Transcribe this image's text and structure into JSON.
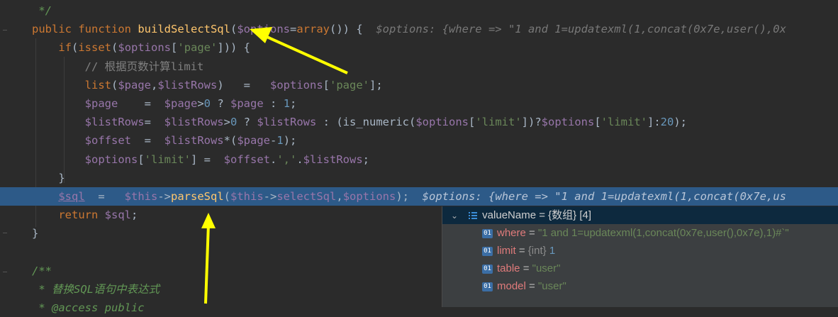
{
  "code_lines": [
    {
      "id": "doc-end",
      "segments": [
        {
          "t": " */",
          "c": "doccmt"
        }
      ]
    },
    {
      "id": "function-decl",
      "segments": [
        {
          "t": "public ",
          "c": "kw"
        },
        {
          "t": "function ",
          "c": "kw"
        },
        {
          "t": "buildSelectSql",
          "c": "fn"
        },
        {
          "t": "(",
          "c": ""
        },
        {
          "t": "$options",
          "c": "var"
        },
        {
          "t": "=",
          "c": ""
        },
        {
          "t": "array",
          "c": "kw"
        },
        {
          "t": "()) {  ",
          "c": ""
        },
        {
          "t": "$options: {where => \"1 and 1=updatexml(1,concat(0x7e,user(),0x",
          "c": "hint"
        }
      ]
    },
    {
      "id": "if-isset",
      "segments": [
        {
          "t": "    ",
          "c": ""
        },
        {
          "t": "if",
          "c": "kw"
        },
        {
          "t": "(",
          "c": ""
        },
        {
          "t": "isset",
          "c": "kw"
        },
        {
          "t": "(",
          "c": ""
        },
        {
          "t": "$options",
          "c": "var"
        },
        {
          "t": "[",
          "c": ""
        },
        {
          "t": "'page'",
          "c": "str"
        },
        {
          "t": "])) {",
          "c": ""
        }
      ]
    },
    {
      "id": "comment-line",
      "segments": [
        {
          "t": "        // 根据页数计算limit",
          "c": "cmt"
        }
      ]
    },
    {
      "id": "list-line",
      "segments": [
        {
          "t": "        ",
          "c": ""
        },
        {
          "t": "list",
          "c": "kw"
        },
        {
          "t": "(",
          "c": ""
        },
        {
          "t": "$page",
          "c": "var"
        },
        {
          "t": ",",
          "c": ""
        },
        {
          "t": "$listRows",
          "c": "var"
        },
        {
          "t": ")   =   ",
          "c": ""
        },
        {
          "t": "$options",
          "c": "var"
        },
        {
          "t": "[",
          "c": ""
        },
        {
          "t": "'page'",
          "c": "str"
        },
        {
          "t": "];",
          "c": ""
        }
      ]
    },
    {
      "id": "page-line",
      "segments": [
        {
          "t": "        ",
          "c": ""
        },
        {
          "t": "$page",
          "c": "var"
        },
        {
          "t": "    =  ",
          "c": ""
        },
        {
          "t": "$page",
          "c": "var"
        },
        {
          "t": ">",
          "c": ""
        },
        {
          "t": "0",
          "c": "num"
        },
        {
          "t": " ? ",
          "c": ""
        },
        {
          "t": "$page",
          "c": "var"
        },
        {
          "t": " : ",
          "c": ""
        },
        {
          "t": "1",
          "c": "num"
        },
        {
          "t": ";",
          "c": ""
        }
      ]
    },
    {
      "id": "listrows-line",
      "segments": [
        {
          "t": "        ",
          "c": ""
        },
        {
          "t": "$listRows",
          "c": "var"
        },
        {
          "t": "=  ",
          "c": ""
        },
        {
          "t": "$listRows",
          "c": "var"
        },
        {
          "t": ">",
          "c": ""
        },
        {
          "t": "0",
          "c": "num"
        },
        {
          "t": " ? ",
          "c": ""
        },
        {
          "t": "$listRows",
          "c": "var"
        },
        {
          "t": " : (is_numeric(",
          "c": ""
        },
        {
          "t": "$options",
          "c": "var"
        },
        {
          "t": "[",
          "c": ""
        },
        {
          "t": "'limit'",
          "c": "str"
        },
        {
          "t": "])?",
          "c": ""
        },
        {
          "t": "$options",
          "c": "var"
        },
        {
          "t": "[",
          "c": ""
        },
        {
          "t": "'limit'",
          "c": "str"
        },
        {
          "t": "]:",
          "c": ""
        },
        {
          "t": "20",
          "c": "num"
        },
        {
          "t": ");",
          "c": ""
        }
      ]
    },
    {
      "id": "offset-line",
      "segments": [
        {
          "t": "        ",
          "c": ""
        },
        {
          "t": "$offset",
          "c": "var"
        },
        {
          "t": "  =  ",
          "c": ""
        },
        {
          "t": "$listRows",
          "c": "var"
        },
        {
          "t": "*(",
          "c": ""
        },
        {
          "t": "$page",
          "c": "var"
        },
        {
          "t": "-",
          "c": ""
        },
        {
          "t": "1",
          "c": "num"
        },
        {
          "t": ");",
          "c": ""
        }
      ]
    },
    {
      "id": "options-limit-line",
      "segments": [
        {
          "t": "        ",
          "c": ""
        },
        {
          "t": "$options",
          "c": "var"
        },
        {
          "t": "[",
          "c": ""
        },
        {
          "t": "'limit'",
          "c": "str"
        },
        {
          "t": "] =  ",
          "c": ""
        },
        {
          "t": "$offset",
          "c": "var"
        },
        {
          "t": ".",
          "c": ""
        },
        {
          "t": "','",
          "c": "str"
        },
        {
          "t": ".",
          "c": ""
        },
        {
          "t": "$listRows",
          "c": "var"
        },
        {
          "t": ";",
          "c": ""
        }
      ]
    },
    {
      "id": "if-close",
      "segments": [
        {
          "t": "    }",
          "c": ""
        }
      ]
    },
    {
      "id": "sql-line",
      "highlight": true,
      "segments": [
        {
          "t": "    ",
          "c": ""
        },
        {
          "t": "$sql",
          "c": "var under"
        },
        {
          "t": "  =   ",
          "c": ""
        },
        {
          "t": "$this",
          "c": "var"
        },
        {
          "t": "->",
          "c": ""
        },
        {
          "t": "parseSql",
          "c": "fn"
        },
        {
          "t": "(",
          "c": ""
        },
        {
          "t": "$this",
          "c": "var"
        },
        {
          "t": "->",
          "c": ""
        },
        {
          "t": "selectSql",
          "c": "var"
        },
        {
          "t": ",",
          "c": ""
        },
        {
          "t": "$options",
          "c": "var"
        },
        {
          "t": ");  ",
          "c": ""
        },
        {
          "t": "$options: {where => \"1 and 1=updatexml(1,concat(0x7e,us",
          "c": "hint"
        }
      ]
    },
    {
      "id": "return-line",
      "segments": [
        {
          "t": "    ",
          "c": ""
        },
        {
          "t": "return ",
          "c": "kw"
        },
        {
          "t": "$sql",
          "c": "var"
        },
        {
          "t": ";",
          "c": ""
        }
      ]
    },
    {
      "id": "function-close",
      "segments": [
        {
          "t": "}",
          "c": ""
        }
      ]
    },
    {
      "id": "blank-line",
      "segments": [
        {
          "t": "",
          "c": ""
        }
      ]
    },
    {
      "id": "doc-open",
      "segments": [
        {
          "t": "/**",
          "c": "doccmt"
        }
      ]
    },
    {
      "id": "doc-desc",
      "segments": [
        {
          "t": " * 替换SQL语句中表达式",
          "c": "doccmt"
        }
      ]
    },
    {
      "id": "doc-access",
      "segments": [
        {
          "t": " * @access public",
          "c": "doccmt"
        }
      ]
    }
  ],
  "debugger": {
    "root": {
      "name": "valueName",
      "sep": " = ",
      "type": "{数组}",
      "count": " [4]"
    },
    "children": [
      {
        "name": "where",
        "sep": " = ",
        "value": "\"1 and 1=updatexml(1,concat(0x7e,user(),0x7e),1)#`\"",
        "kind": "str"
      },
      {
        "name": "limit",
        "sep": " = ",
        "type": "{int} ",
        "value": "1",
        "kind": "num"
      },
      {
        "name": "table",
        "sep": " = ",
        "value": "\"user\"",
        "kind": "str"
      },
      {
        "name": "model",
        "sep": " = ",
        "value": "\"user\"",
        "kind": "str"
      }
    ],
    "badge": "01"
  },
  "colors": {
    "editor_bg": "#2b2b2b",
    "highlight_line": "#2d5a88",
    "arrow": "#ffff00"
  }
}
